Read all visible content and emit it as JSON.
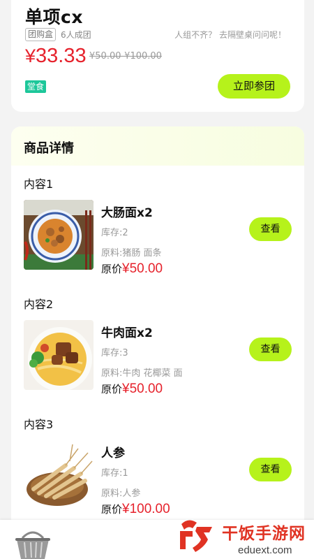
{
  "product": {
    "title": "单项cx",
    "tag": "团购盒",
    "group_size": "6人成团",
    "hint": "人组不齐？ 去隔壁桌问问呢！",
    "price": "33.33",
    "price_symbol": "¥",
    "original_range": "¥50.00-¥100.00",
    "dine_tag": "堂食",
    "join_button": "立即参团"
  },
  "details": {
    "title": "商品详情",
    "view_label": "查看",
    "price_prefix": "原价",
    "items": [
      {
        "section": "内容1",
        "name": "大肠面x2",
        "stock": "库存:2",
        "ingredients": "原料:猪肠 面条",
        "price": "¥50.00"
      },
      {
        "section": "内容2",
        "name": "牛肉面x2",
        "stock": "库存:3",
        "ingredients": "原料:牛肉 花椰菜 面",
        "price": "¥50.00"
      },
      {
        "section": "内容3",
        "name": "人参",
        "stock": "库存:1",
        "ingredients": "原料:人参",
        "price": "¥100.00"
      }
    ]
  },
  "watermark": {
    "brand": "干饭手游网",
    "url": "eduext.com"
  },
  "colors": {
    "accent_green": "#b6f21b",
    "price_red": "#e6222c",
    "tag_green": "#1dc79a"
  },
  "icons": [
    "basket-icon",
    "watermark-logo"
  ]
}
